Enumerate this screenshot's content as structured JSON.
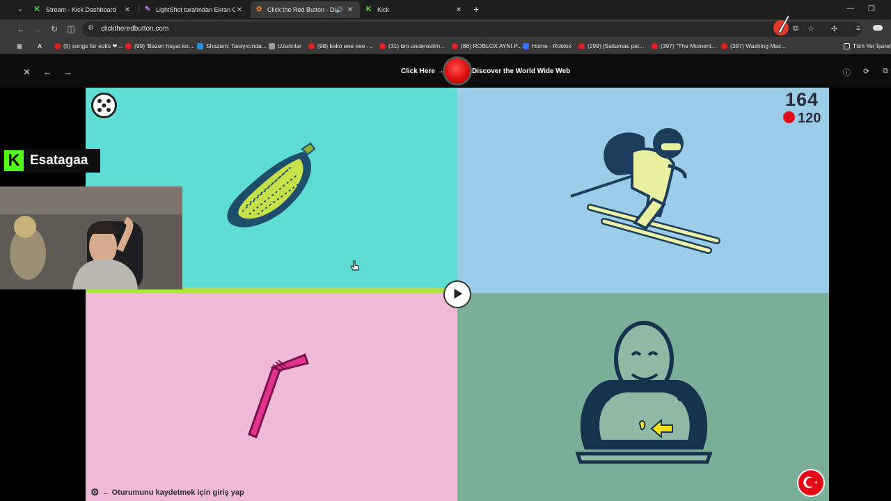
{
  "tabs": [
    {
      "label": "Stream - Kick Dashboard",
      "icon": "kick-icon",
      "active": false
    },
    {
      "label": "LightShot tarafından Ekran Gör",
      "icon": "lightshot-icon",
      "active": false
    },
    {
      "label": "Click the Red Button - Disc",
      "icon": "crb-icon",
      "active": true
    },
    {
      "label": "Kick",
      "icon": "kick-icon",
      "active": false
    }
  ],
  "address": {
    "url": "clicktheredbutton.com"
  },
  "bookmarks": [
    {
      "label": "(5) songs for edits ❤...",
      "icon": "youtube-icon"
    },
    {
      "label": "(99) 'Bazen hayat ko...",
      "icon": "youtube-icon"
    },
    {
      "label": "Shazam: Tarayıcında...",
      "icon": "shazam-icon"
    },
    {
      "label": "Uzantılar",
      "icon": "puzzle-icon"
    },
    {
      "label": "(98) keko eee eee -...",
      "icon": "youtube-icon"
    },
    {
      "label": "(31) bro underestim...",
      "icon": "youtube-icon"
    },
    {
      "label": "(86) ROBLOX AYNI P...",
      "icon": "youtube-icon"
    },
    {
      "label": "Home - Roblox",
      "icon": "roblox-icon"
    },
    {
      "label": "(299) [Saitamas pet...",
      "icon": "youtube-icon"
    },
    {
      "label": "(397) \"The Moment...",
      "icon": "youtube-icon"
    },
    {
      "label": "(397) Washing Mac...",
      "icon": "youtube-icon"
    },
    {
      "label": "Tüm Yer İşaretl",
      "icon": "folder-icon"
    }
  ],
  "page": {
    "click_here": "Click Here →",
    "discover": "Discover the World Wide Web",
    "score_main": "164",
    "score_sub": "120",
    "progress": 1.0,
    "bottom_link": "← Oturumunu kaydetmek için giriş yap"
  },
  "streamer": {
    "name": "Esatagaa",
    "logo": "K"
  },
  "colors": {
    "accent_red": "#e01010",
    "kick_green": "#53fc18",
    "q1": "#5fdcd4",
    "q2": "#9ccde8",
    "q3": "#efbad8",
    "q4": "#7aae98",
    "progress": "#a9e54a"
  }
}
